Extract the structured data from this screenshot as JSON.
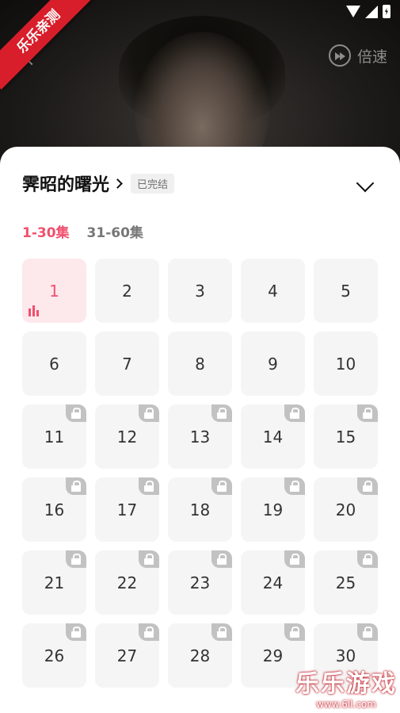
{
  "ribbon": "乐乐亲测",
  "player": {
    "speed_label": "倍速"
  },
  "drama": {
    "title": "霁昭的曙光",
    "status": "已完结"
  },
  "ranges": [
    {
      "label": "1-30集",
      "active": true
    },
    {
      "label": "31-60集",
      "active": false
    }
  ],
  "episodes": [
    {
      "num": "1",
      "active": true,
      "locked": false
    },
    {
      "num": "2",
      "locked": false
    },
    {
      "num": "3",
      "locked": false
    },
    {
      "num": "4",
      "locked": false
    },
    {
      "num": "5",
      "locked": false
    },
    {
      "num": "6",
      "locked": false
    },
    {
      "num": "7",
      "locked": false
    },
    {
      "num": "8",
      "locked": false
    },
    {
      "num": "9",
      "locked": false
    },
    {
      "num": "10",
      "locked": false
    },
    {
      "num": "11",
      "locked": true
    },
    {
      "num": "12",
      "locked": true
    },
    {
      "num": "13",
      "locked": true
    },
    {
      "num": "14",
      "locked": true
    },
    {
      "num": "15",
      "locked": true
    },
    {
      "num": "16",
      "locked": true
    },
    {
      "num": "17",
      "locked": true
    },
    {
      "num": "18",
      "locked": true
    },
    {
      "num": "19",
      "locked": true
    },
    {
      "num": "20",
      "locked": true
    },
    {
      "num": "21",
      "locked": true
    },
    {
      "num": "22",
      "locked": true
    },
    {
      "num": "23",
      "locked": true
    },
    {
      "num": "24",
      "locked": true
    },
    {
      "num": "25",
      "locked": true
    },
    {
      "num": "26",
      "locked": true
    },
    {
      "num": "27",
      "locked": true
    },
    {
      "num": "28",
      "locked": true
    },
    {
      "num": "29",
      "locked": true
    },
    {
      "num": "30",
      "locked": true
    }
  ],
  "watermark": {
    "title": "乐乐游戏",
    "url": "www.6ll.com"
  },
  "colors": {
    "accent": "#f0506e",
    "active_bg": "#fde8ec",
    "lock": "#c2c2c2"
  }
}
